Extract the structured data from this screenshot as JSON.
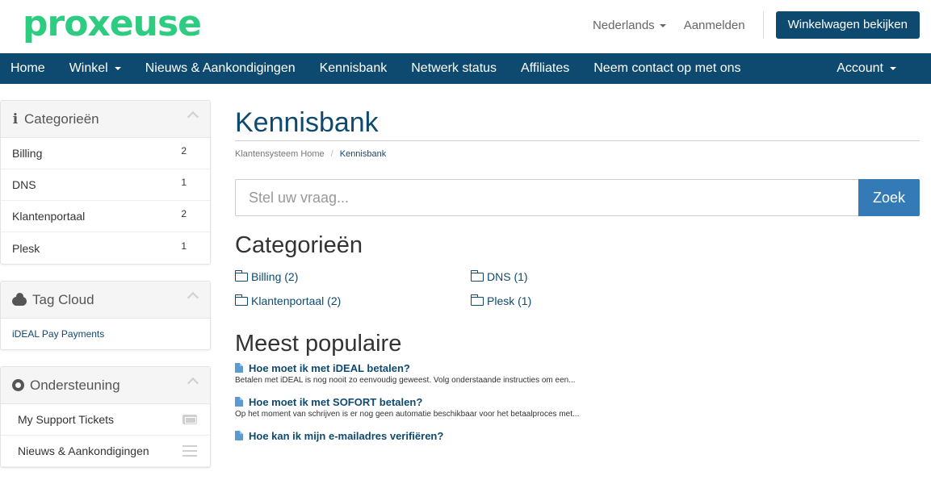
{
  "header": {
    "logo": "proxeuse",
    "language": "Nederlands",
    "login": "Aanmelden",
    "cart_button": "Winkelwagen bekijken"
  },
  "nav": {
    "items": [
      {
        "label": "Home"
      },
      {
        "label": "Winkel",
        "dropdown": true
      },
      {
        "label": "Nieuws & Aankondigingen"
      },
      {
        "label": "Kennisbank"
      },
      {
        "label": "Netwerk status"
      },
      {
        "label": "Affiliates"
      },
      {
        "label": "Neem contact op met ons"
      }
    ],
    "account": "Account"
  },
  "sidebar": {
    "categories": {
      "title": "Categorieën",
      "icon": "info-icon",
      "items": [
        {
          "label": "Billing",
          "count": "2"
        },
        {
          "label": "DNS",
          "count": "1"
        },
        {
          "label": "Klantenportaal",
          "count": "2"
        },
        {
          "label": "Plesk",
          "count": "1"
        }
      ]
    },
    "tag_cloud": {
      "title": "Tag Cloud",
      "icon": "cloud-icon",
      "tag": "iDEAL Pay Payments"
    },
    "support": {
      "title": "Ondersteuning",
      "icon": "lifebuoy-icon",
      "items": [
        {
          "label": "My Support Tickets",
          "icon": "ticket-icon"
        },
        {
          "label": "Nieuws & Aankondigingen",
          "icon": "list-icon"
        }
      ]
    }
  },
  "main": {
    "title": "Kennisbank",
    "breadcrumb": {
      "home": "Klantensysteem Home",
      "separator": "/",
      "current": "Kennisbank"
    },
    "search": {
      "placeholder": "Stel uw vraag...",
      "button": "Zoek"
    },
    "categories_heading": "Categorieën",
    "categories": [
      "Billing (2)",
      "DNS (1)",
      "Klantenportaal (2)",
      "Plesk (1)"
    ],
    "popular_heading": "Meest populaire",
    "popular": [
      {
        "title": "Hoe moet ik met iDEAL betalen?",
        "desc": "Betalen met iDEAL is nog nooit zo eenvoudig geweest. Volg onderstaande instructies om een..."
      },
      {
        "title": "Hoe moet ik met SOFORT betalen?",
        "desc": "Op het moment van schrijven is er nog geen automatie beschikbaar voor het betaalproces met..."
      },
      {
        "title": "Hoe kan ik mijn e-mailadres verifiëren?",
        "desc": ""
      }
    ]
  },
  "colors": {
    "brand": "#2ecc80",
    "nav_bg": "#0e4a70",
    "primary_button": "#337ab7"
  }
}
